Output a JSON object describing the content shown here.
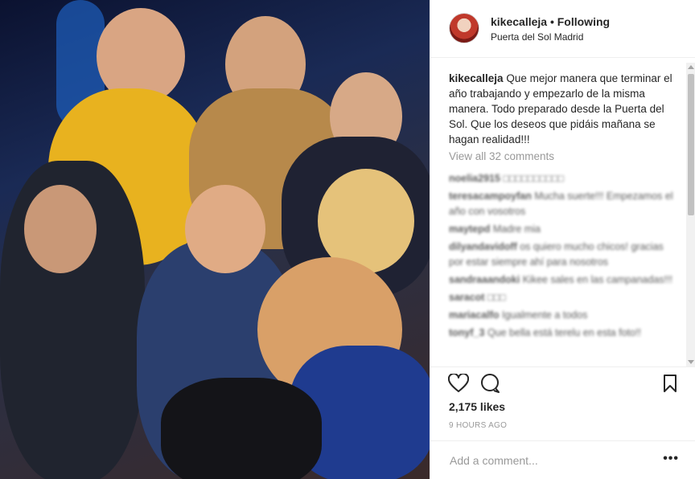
{
  "post": {
    "username": "kikecalleja",
    "separator": "•",
    "follow_status": "Following",
    "location": "Puerta del Sol Madrid",
    "caption_user": "kikecalleja",
    "caption_text": "Que mejor manera que terminar el año trabajando y empezarlo de la misma manera. Todo preparado desde la Puerta del Sol. Que los deseos que pidáis mañana se hagan realidad!!!",
    "view_all": "View all 32 comments",
    "likes": "2,175 likes",
    "time": "9 HOURS AGO",
    "comment_placeholder": "Add a comment...",
    "more": "•••"
  },
  "comments": [
    {
      "user": "noelia2915",
      "text": "□□□□□□□□□□"
    },
    {
      "user": "teresacampoyfan",
      "text": "Mucha suerte!!! Empezamos el año con vosotros"
    },
    {
      "user": "maytepd",
      "text": "Madre mia"
    },
    {
      "user": "dilyandavidoff",
      "text": "os quiero mucho chicos! gracias por estar siempre ahí para nosotros"
    },
    {
      "user": "sandraaandoki",
      "text": "Kikee sales en las campanadas!!!"
    },
    {
      "user": "saracot",
      "text": "□□□"
    },
    {
      "user": "mariacalfo",
      "text": "Igualmente a todos"
    },
    {
      "user": "tonyf_3",
      "text": "Que bella está terelu en esta foto!!"
    }
  ],
  "icons": {
    "heart": "heart-icon",
    "comment": "comment-icon",
    "bookmark": "bookmark-icon"
  }
}
